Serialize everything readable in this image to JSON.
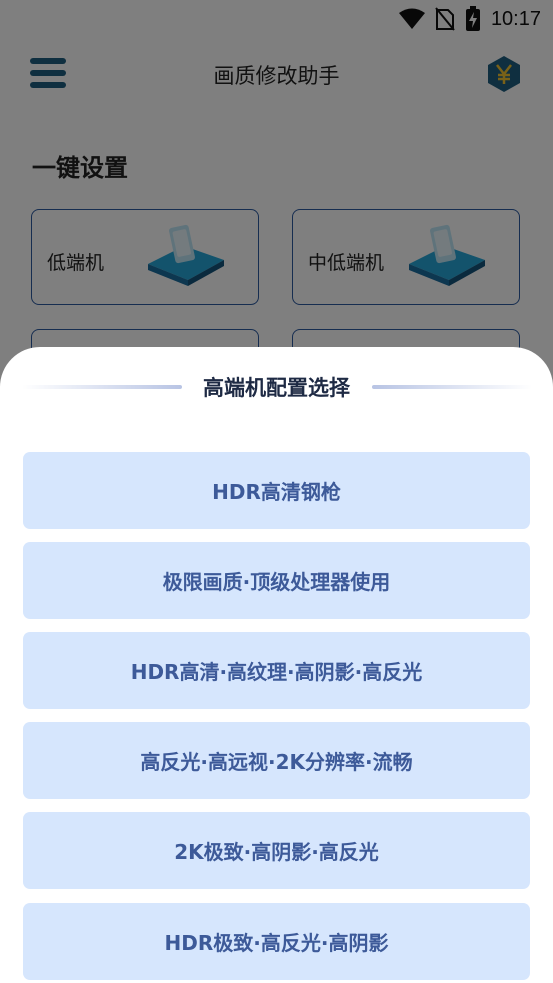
{
  "status_bar": {
    "time": "10:17"
  },
  "header": {
    "title": "画质修改助手"
  },
  "main": {
    "section_title": "一键设置",
    "cards": [
      {
        "label": "低端机"
      },
      {
        "label": "中低端机"
      }
    ]
  },
  "sheet": {
    "title": "高端机配置选择",
    "options": [
      "HDR高清钢枪",
      "极限画质·顶级处理器使用",
      "HDR高清·高纹理·高阴影·高反光",
      "高反光·高远视·2K分辨率·流畅",
      "2K极致·高阴影·高反光",
      "HDR极致·高反光·高阴影"
    ]
  },
  "colors": {
    "accent": "#2c5aa0",
    "menu_icon": "#1f5f80",
    "option_bg": "#d6e6fd",
    "option_text": "#3d5a99"
  },
  "icons": [
    "wifi-icon",
    "no-sim-icon",
    "battery-charging-icon",
    "menu-icon",
    "yen-icon",
    "phone-illustration"
  ]
}
